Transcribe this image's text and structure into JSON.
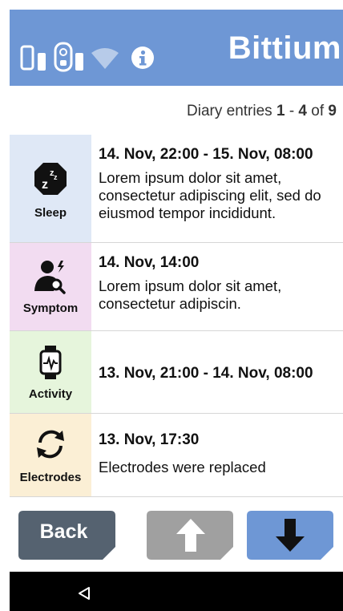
{
  "header": {
    "logo": "Bittium",
    "icons": [
      "phone-icon",
      "device-icon",
      "wifi-icon",
      "info-icon"
    ],
    "color": "#6e97d5"
  },
  "pager": {
    "prefix": "Diary entries",
    "from": "1",
    "separator": "-",
    "to": "4",
    "of_word": "of",
    "total": "9"
  },
  "entries": [
    {
      "category": "Sleep",
      "icon": "sleep-icon",
      "color": "#dfe8f6",
      "date": "14. Nov, 22:00 - 15. Nov, 08:00",
      "desc": "Lorem ipsum dolor sit amet, consectetur adipiscing elit, sed do eiusmod tempor incididunt."
    },
    {
      "category": "Symptom",
      "icon": "symptom-icon",
      "color": "#f2dcf1",
      "date": "14. Nov, 14:00",
      "desc": "Lorem ipsum dolor sit amet, consectetur adipiscin."
    },
    {
      "category": "Activity",
      "icon": "activity-icon",
      "color": "#e6f5dc",
      "date": "13. Nov, 21:00 - 14. Nov, 08:00",
      "desc": ""
    },
    {
      "category": "Electrodes",
      "icon": "electrodes-icon",
      "color": "#fbefd5",
      "date": "13. Nov, 17:30",
      "desc": "Electrodes were replaced"
    }
  ],
  "buttons": {
    "back_label": "Back",
    "back_color": "#556270",
    "up_icon": "arrow-up-icon",
    "up_color": "#a0a0a0",
    "down_icon": "arrow-down-icon",
    "down_color": "#6e97d5"
  },
  "navbar": {
    "back_icon": "triangle-back-icon"
  }
}
